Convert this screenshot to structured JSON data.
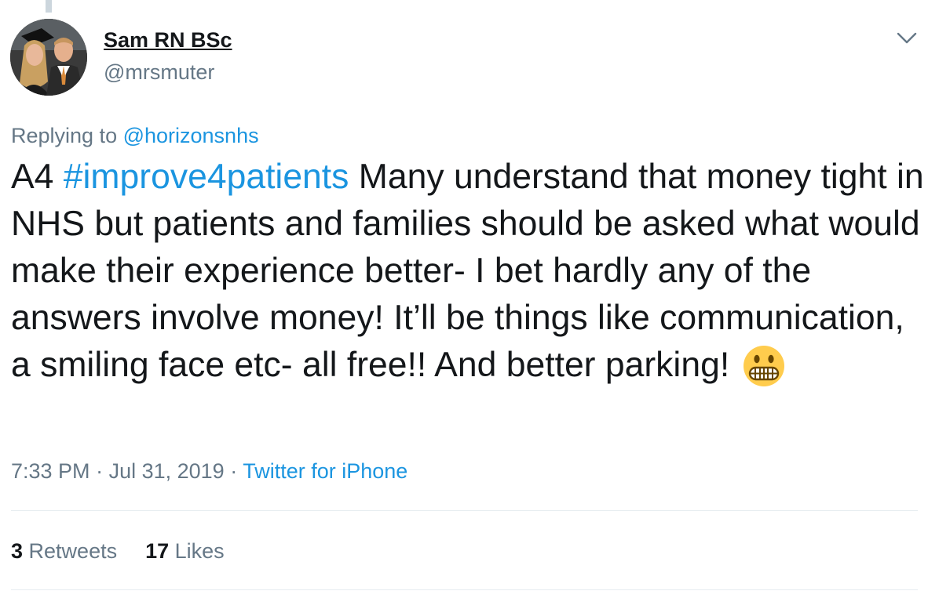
{
  "author": {
    "display_name": "Sam RN BSc",
    "handle": "@mrsmuter"
  },
  "reply": {
    "prefix": "Replying to ",
    "mention": "@horizonsnhs"
  },
  "tweet": {
    "text_before_hashtag": "A4 ",
    "hashtag": "#improve4patients",
    "text_after_hashtag": " Many understand that money tight in NHS but patients and families should be asked what would make their experience better- I bet hardly any of the answers involve money! It’ll be things like communication, a smiling face etc- all free!! And better parking! ",
    "emoji": "grimacing-face-emoji"
  },
  "meta": {
    "time": "7:33 PM",
    "separator": " · ",
    "date": "Jul 31, 2019",
    "source": "Twitter for iPhone"
  },
  "stats": {
    "retweets_count": "3",
    "retweets_label": " Retweets",
    "likes_count": "17",
    "likes_label": " Likes"
  },
  "colors": {
    "link": "#1b95e0",
    "secondary_text": "#657786",
    "primary_text": "#14171a",
    "divider": "#e6ecf0"
  }
}
